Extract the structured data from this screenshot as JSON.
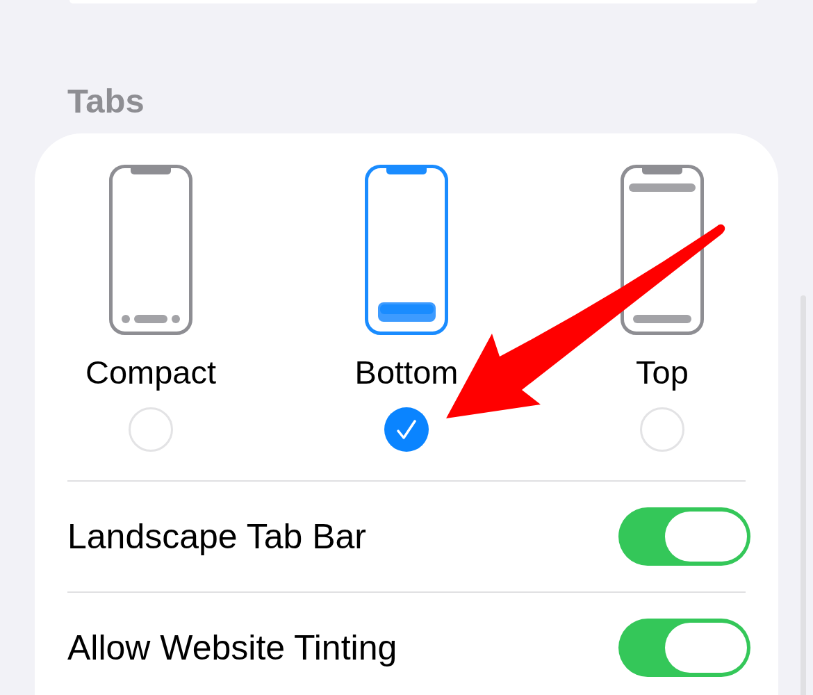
{
  "section": {
    "title": "Tabs"
  },
  "tab_layouts": [
    {
      "kind": "compact",
      "label": "Compact",
      "selected": false
    },
    {
      "kind": "bottom",
      "label": "Bottom",
      "selected": true
    },
    {
      "kind": "top",
      "label": "Top",
      "selected": false
    }
  ],
  "toggles": [
    {
      "label": "Landscape Tab Bar",
      "on": true
    },
    {
      "label": "Allow Website Tinting",
      "on": true
    }
  ],
  "annotations": [
    {
      "kind": "arrow"
    }
  ]
}
